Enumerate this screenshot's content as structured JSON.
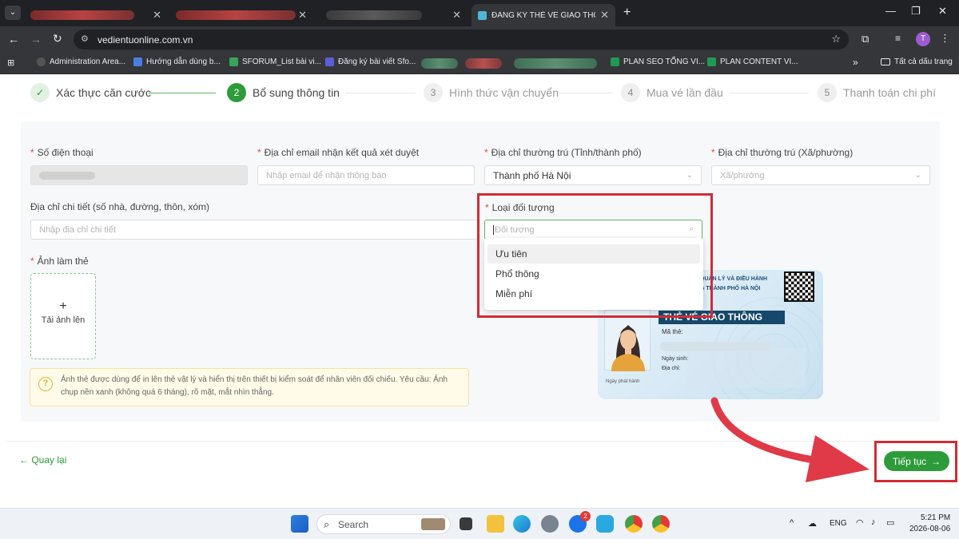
{
  "browser": {
    "active_tab_title": "ĐĂNG KÝ THẺ VÉ GIAO THÔNG",
    "url": "vedientuonline.com.vn",
    "profile_initial": "T",
    "bookmarks": [
      {
        "label": "Administration Area..."
      },
      {
        "label": "Hướng dẫn dùng b..."
      },
      {
        "label": "SFORUM_List bài vi..."
      },
      {
        "label": "Đăng ký bài viết Sfo..."
      },
      {
        "label": "PLAN SEO TỔNG VI..."
      },
      {
        "label": "PLAN CONTENT VI..."
      }
    ],
    "all_bookmarks": "Tất cả dấu trang",
    "overflow": "»"
  },
  "stepper": {
    "steps": [
      {
        "num": "✓",
        "label": "Xác thực căn cước"
      },
      {
        "num": "2",
        "label": "Bổ sung thông tin"
      },
      {
        "num": "3",
        "label": "Hình thức vận chuyển"
      },
      {
        "num": "4",
        "label": "Mua vé lần đầu"
      },
      {
        "num": "5",
        "label": "Thanh toán chi phí"
      }
    ]
  },
  "form": {
    "phone_label": "Số điện thoại",
    "email_label": "Địa chỉ email nhận kết quả xét duyệt",
    "email_placeholder": "Nhập email để nhận thông báo",
    "province_label": "Địa chỉ thường trú (Tỉnh/thành phố)",
    "province_value": "Thành phố Hà Nội",
    "ward_label": "Địa chỉ thường trú (Xã/phường)",
    "ward_placeholder": "Xã/phường",
    "detail_label": "Địa chỉ chi tiết (số nhà, đường, thôn, xóm)",
    "detail_placeholder": "Nhập địa chỉ chi tiết",
    "type_label": "Loại đối tượng",
    "type_placeholder": "Đối tượng",
    "type_options": [
      "Ưu tiên",
      "Phổ thông",
      "Miễn phí"
    ],
    "photo_label": "Ảnh làm thẻ",
    "upload_plus": "+",
    "upload_label": "Tải ảnh lên",
    "notice_icon": "?",
    "notice_text": "Ảnh thẻ được dùng để in lên thẻ vật lý và hiển thị trên thiết bị kiểm soát để nhân viên đối chiếu. Yêu cầu: Ảnh chụp nền xanh (không quá 6 tháng), rõ mặt, mắt nhìn thẳng."
  },
  "card": {
    "header_line1": "QUẢN LÝ VÀ ĐIỀU HÀNH",
    "header_line2": "G THÀNH PHỐ HÀ NỘI",
    "title": "THẺ VÉ GIAO THÔNG",
    "id_label": "Mã thẻ:",
    "dob_label": "Ngày sinh:",
    "address_label": "Địa chỉ:",
    "issue_label": "Ngày phát hành"
  },
  "footer": {
    "back_label": "Quay lại",
    "next_label": "Tiếp tục"
  },
  "taskbar": {
    "search_label": "Search",
    "lang": "ENG",
    "time": "5:21 PM",
    "date": "2026-08-06",
    "badge_count": "2"
  },
  "colors": {
    "accent": "#2e9b3a",
    "highlight": "#d22b35"
  }
}
